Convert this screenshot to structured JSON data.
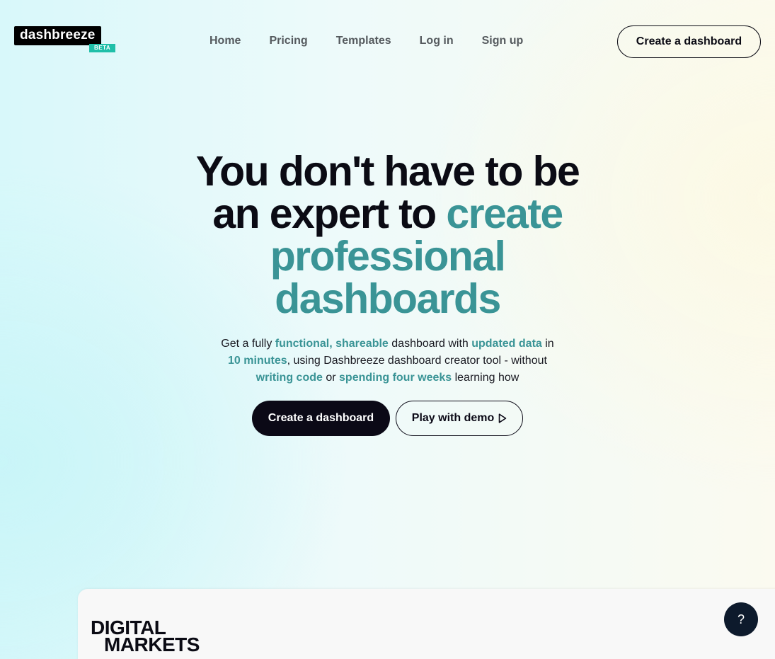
{
  "header": {
    "logo_text": "dashbreeze",
    "logo_badge": "BETA",
    "nav": [
      "Home",
      "Pricing",
      "Templates",
      "Log in",
      "Sign up"
    ],
    "cta_label": "Create a dashboard"
  },
  "hero": {
    "title_line1": "You don't have to be",
    "title_line2_plain": "an expert to ",
    "title_line2_accent": "create",
    "title_line3_accent": "professional",
    "title_line4_accent": "dashboards",
    "sub": {
      "p1": "Get a fully ",
      "h1": "functional, shareable",
      "p2": " dashboard with ",
      "h2": "updated data",
      "p3": " in",
      "h3": "10 minutes",
      "p4": ", using Dashbreeze dashboard creator tool - without",
      "h4": "writing code",
      "p5": " or ",
      "h5": "spending four weeks",
      "p6": " learning how"
    },
    "primary_cta": "Create a dashboard",
    "secondary_cta": "Play with demo"
  },
  "preview": {
    "brand_line1": "DIGITAL",
    "brand_line2": "MARKETS"
  },
  "help_button": "?",
  "colors": {
    "accent": "#3a9496",
    "dark": "#0b0916",
    "badge": "#1fbfa8"
  }
}
